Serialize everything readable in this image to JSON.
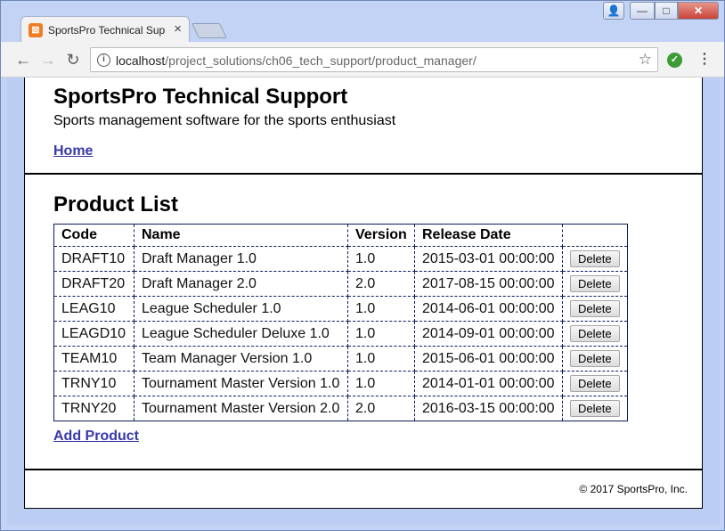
{
  "browser": {
    "tab": {
      "title": "SportsPro Technical Support",
      "favicon": "xampp-icon",
      "close_glyph": "×"
    },
    "window_controls": {
      "user": "👤",
      "minimize": "—",
      "maximize": "□",
      "close": "✕"
    },
    "nav": {
      "back": "←",
      "forward": "→",
      "reload": "↻"
    },
    "address": {
      "info_glyph": "i",
      "host": "localhost",
      "path": "/project_solutions/ch06_tech_support/product_manager/",
      "star": "☆"
    },
    "extension_glyph": "✓",
    "menu_glyph": "⋮"
  },
  "header": {
    "title": "SportsPro Technical Support",
    "tagline": "Sports management software for the sports enthusiast",
    "home_link": "Home"
  },
  "main": {
    "heading": "Product List",
    "columns": [
      "Code",
      "Name",
      "Version",
      "Release Date",
      ""
    ],
    "delete_label": "Delete",
    "rows": [
      {
        "code": "DRAFT10",
        "name": "Draft Manager 1.0",
        "version": "1.0",
        "release_date": "2015-03-01 00:00:00"
      },
      {
        "code": "DRAFT20",
        "name": "Draft Manager 2.0",
        "version": "2.0",
        "release_date": "2017-08-15 00:00:00"
      },
      {
        "code": "LEAG10",
        "name": "League Scheduler 1.0",
        "version": "1.0",
        "release_date": "2014-06-01 00:00:00"
      },
      {
        "code": "LEAGD10",
        "name": "League Scheduler Deluxe 1.0",
        "version": "1.0",
        "release_date": "2014-09-01 00:00:00"
      },
      {
        "code": "TEAM10",
        "name": "Team Manager Version 1.0",
        "version": "1.0",
        "release_date": "2015-06-01 00:00:00"
      },
      {
        "code": "TRNY10",
        "name": "Tournament Master Version 1.0",
        "version": "1.0",
        "release_date": "2014-01-01 00:00:00"
      },
      {
        "code": "TRNY20",
        "name": "Tournament Master Version 2.0",
        "version": "2.0",
        "release_date": "2016-03-15 00:00:00"
      }
    ],
    "add_link": "Add Product"
  },
  "footer": {
    "copyright": "© 2017 SportsPro, Inc."
  },
  "colors": {
    "link": "#3639a8",
    "page_background": "#bccdf3",
    "table_border": "#0b1b5c"
  }
}
